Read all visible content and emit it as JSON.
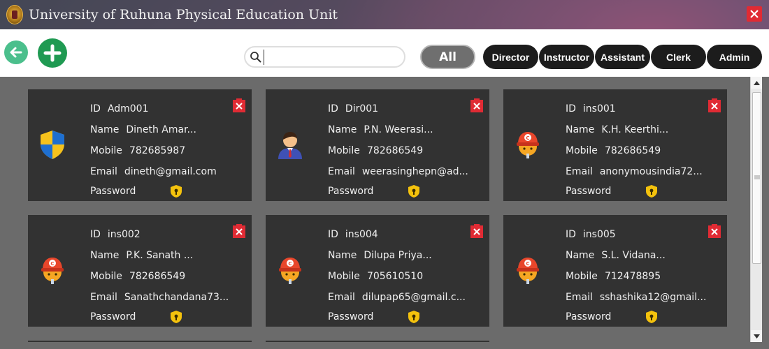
{
  "window": {
    "title": "University of Ruhuna Physical Education Unit",
    "close_label": "X"
  },
  "toolbar": {
    "search_placeholder": "",
    "filters": [
      "All",
      "Director",
      "Instructor",
      "Assistant",
      "Clerk",
      "Admin"
    ],
    "selected_filter": "All"
  },
  "labels": {
    "id": "ID",
    "name": "Name",
    "mobile": "Mobile",
    "email": "Email",
    "password": "Password"
  },
  "users": [
    {
      "id": "Adm001",
      "name": "Dineth Amar...",
      "mobile": "782685987",
      "email": "dineth@gmail.com",
      "avatar": "admin-shield-icon"
    },
    {
      "id": "Dir001",
      "name": "P.N. Weerasi...",
      "mobile": "782686549",
      "email": "weerasinghepn@ad...",
      "avatar": "director-avatar-icon"
    },
    {
      "id": "ins001",
      "name": "K.H. Keerthi...",
      "mobile": "782686549",
      "email": "anonymousindia72...",
      "avatar": "instructor-avatar-icon"
    },
    {
      "id": "ins002",
      "name": "P.K. Sanath ...",
      "mobile": "782686549",
      "email": "Sanathchandana73...",
      "avatar": "instructor-avatar-icon"
    },
    {
      "id": "ins004",
      "name": "Dilupa Priya...",
      "mobile": "705610510",
      "email": "dilupap65@gmail.c...",
      "avatar": "instructor-avatar-icon"
    },
    {
      "id": "ins005",
      "name": "S.L. Vidana...",
      "mobile": "712478895",
      "email": "sshashika12@gmail...",
      "avatar": "instructor-avatar-icon"
    }
  ],
  "colors": {
    "card_bg": "#323232",
    "panel_bg": "#6b6b6b",
    "delete_red": "#e02b34",
    "key_yellow": "#f4c20d",
    "add_green": "#1f9a52",
    "back_green": "#4bbf8c"
  }
}
